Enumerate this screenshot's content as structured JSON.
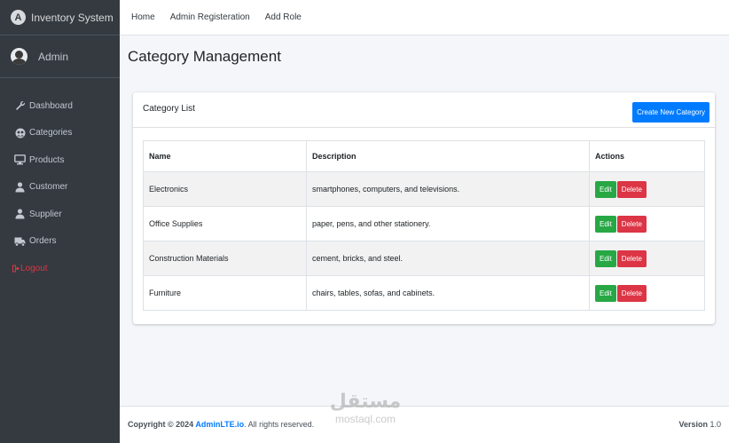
{
  "brand": {
    "name": "Inventory System",
    "logo_letter": "A"
  },
  "user": {
    "name": "Admin"
  },
  "sidebar": {
    "items": [
      {
        "label": "Dashboard",
        "icon": "wrench-icon"
      },
      {
        "label": "Categories",
        "icon": "group-icon"
      },
      {
        "label": "Products",
        "icon": "desktop-icon"
      },
      {
        "label": "Customer",
        "icon": "user-icon"
      },
      {
        "label": "Supplier",
        "icon": "user-icon"
      },
      {
        "label": "Orders",
        "icon": "truck-icon"
      }
    ],
    "logout": {
      "label": "Logout",
      "icon": "sign-out-icon"
    }
  },
  "topnav": {
    "links": [
      "Home",
      "Admin Registeration",
      "Add Role"
    ]
  },
  "page": {
    "title": "Category Management"
  },
  "card": {
    "title": "Category List",
    "create_button": "Create New Category",
    "columns": [
      "Name",
      "Description",
      "Actions"
    ],
    "rows": [
      {
        "name": "Electronics",
        "description": "smartphones, computers, and televisions."
      },
      {
        "name": "Office Supplies",
        "description": "paper, pens, and other stationery."
      },
      {
        "name": "Construction Materials",
        "description": "cement, bricks, and steel."
      },
      {
        "name": "Furniture",
        "description": "chairs, tables, sofas, and cabinets."
      }
    ],
    "edit_label": "Edit",
    "delete_label": "Delete"
  },
  "footer": {
    "copyright_prefix": "Copyright © 2024 ",
    "brand_link": "AdminLTE.io",
    "suffix": ". All rights reserved.",
    "version_label": "Version",
    "version_value": "1.0"
  },
  "watermark": {
    "arabic": "مستقل",
    "latin": "mostaql.com"
  },
  "colors": {
    "sidebar": "#343a40",
    "primary": "#007bff",
    "success": "#28a745",
    "danger": "#dc3545"
  }
}
